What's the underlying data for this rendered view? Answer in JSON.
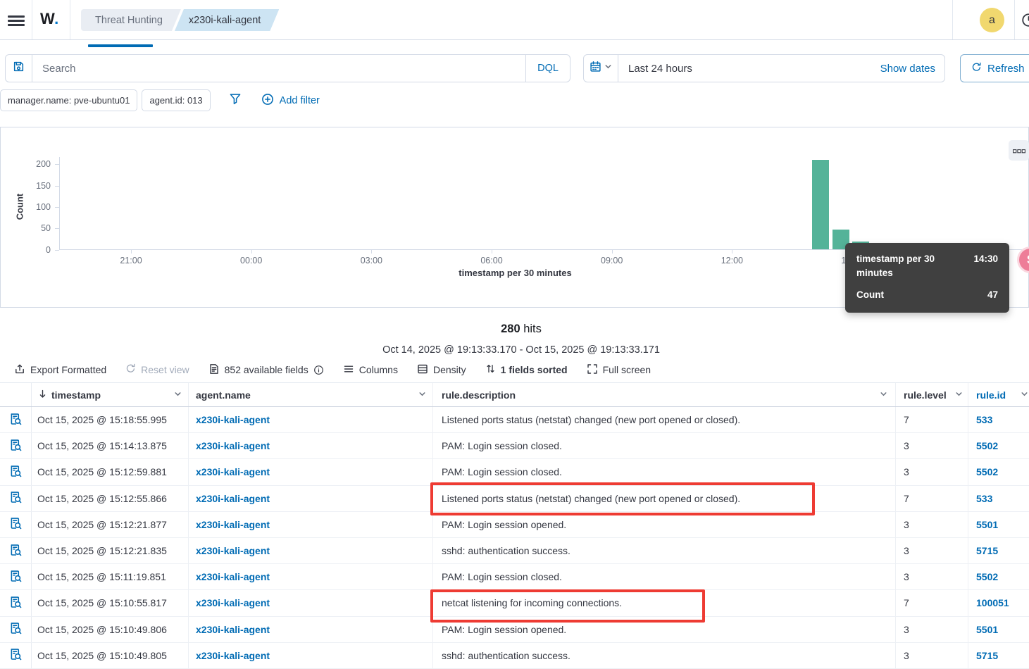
{
  "header": {
    "logo_text": "W",
    "logo_dot": ".",
    "breadcrumbs": [
      {
        "label": "Threat Hunting"
      },
      {
        "label": "x230i-kali-agent"
      }
    ],
    "avatar_initial": "a"
  },
  "search": {
    "placeholder": "Search",
    "language": "DQL"
  },
  "datepicker": {
    "range_label": "Last 24 hours",
    "show_dates_label": "Show dates",
    "refresh_label": "Refresh"
  },
  "filters": {
    "pills": [
      {
        "label": "manager.name: pve-ubuntu01"
      },
      {
        "label": "agent.id: 013"
      }
    ],
    "add_filter_label": "Add filter"
  },
  "chart_data": {
    "type": "bar",
    "title": "",
    "xlabel": "timestamp per 30 minutes",
    "ylabel": "Count",
    "x_ticks": [
      "21:00",
      "00:00",
      "03:00",
      "06:00",
      "09:00",
      "12:00",
      "15:00"
    ],
    "y_ticks": [
      0,
      50,
      100,
      150,
      200
    ],
    "ylim": [
      0,
      220
    ],
    "bars": [
      {
        "time": "14:00",
        "count": 211
      },
      {
        "time": "14:30",
        "count": 47
      },
      {
        "time": "15:00",
        "count": 19
      }
    ],
    "bar_color": "#54b399",
    "legend": "none",
    "grid": "off"
  },
  "tooltip": {
    "label": "timestamp per 30 minutes",
    "time": "14:30",
    "count_label": "Count",
    "count_value": "47"
  },
  "results": {
    "hits_count": "280",
    "hits_label": " hits",
    "range": "Oct 14, 2025 @ 19:13:33.170 - Oct 15, 2025 @ 19:13:33.171"
  },
  "toolbar": {
    "items": [
      {
        "icon": "export-icon",
        "label": "Export Formatted",
        "disabled": false,
        "bold": false,
        "info": false
      },
      {
        "icon": "reset-icon",
        "label": "Reset view",
        "disabled": true,
        "bold": false,
        "info": false
      },
      {
        "icon": "fields-icon",
        "label": "852 available fields",
        "disabled": false,
        "bold": false,
        "info": true
      },
      {
        "icon": "columns-icon",
        "label": "Columns",
        "disabled": false,
        "bold": false,
        "info": false
      },
      {
        "icon": "density-icon",
        "label": "Density",
        "disabled": false,
        "bold": false,
        "info": false
      },
      {
        "icon": "sort-icon",
        "label": "1 fields sorted",
        "disabled": false,
        "bold": true,
        "info": false
      },
      {
        "icon": "fullscreen-icon",
        "label": "Full screen",
        "disabled": false,
        "bold": false,
        "info": false
      }
    ]
  },
  "table": {
    "columns": {
      "timestamp": "timestamp",
      "agent": "agent.name",
      "description": "rule.description",
      "level": "rule.level",
      "id": "rule.id"
    },
    "rows": [
      {
        "timestamp": "Oct 15, 2025 @ 15:18:55.995",
        "agent": "x230i-kali-agent",
        "description": "Listened ports status (netstat) changed (new port opened or closed).",
        "level": "7",
        "id": "533"
      },
      {
        "timestamp": "Oct 15, 2025 @ 15:14:13.875",
        "agent": "x230i-kali-agent",
        "description": "PAM: Login session closed.",
        "level": "3",
        "id": "5502"
      },
      {
        "timestamp": "Oct 15, 2025 @ 15:12:59.881",
        "agent": "x230i-kali-agent",
        "description": "PAM: Login session closed.",
        "level": "3",
        "id": "5502"
      },
      {
        "timestamp": "Oct 15, 2025 @ 15:12:55.866",
        "agent": "x230i-kali-agent",
        "description": "Listened ports status (netstat) changed (new port opened or closed).",
        "level": "7",
        "id": "533"
      },
      {
        "timestamp": "Oct 15, 2025 @ 15:12:21.877",
        "agent": "x230i-kali-agent",
        "description": "PAM: Login session opened.",
        "level": "3",
        "id": "5501"
      },
      {
        "timestamp": "Oct 15, 2025 @ 15:12:21.835",
        "agent": "x230i-kali-agent",
        "description": "sshd: authentication success.",
        "level": "3",
        "id": "5715"
      },
      {
        "timestamp": "Oct 15, 2025 @ 15:11:19.851",
        "agent": "x230i-kali-agent",
        "description": "PAM: Login session closed.",
        "level": "3",
        "id": "5502"
      },
      {
        "timestamp": "Oct 15, 2025 @ 15:10:55.817",
        "agent": "x230i-kali-agent",
        "description": "netcat listening for incoming connections.",
        "level": "7",
        "id": "100051"
      },
      {
        "timestamp": "Oct 15, 2025 @ 15:10:49.806",
        "agent": "x230i-kali-agent",
        "description": "PAM: Login session opened.",
        "level": "3",
        "id": "5501"
      },
      {
        "timestamp": "Oct 15, 2025 @ 15:10:49.805",
        "agent": "x230i-kali-agent",
        "description": "sshd: authentication success.",
        "level": "3",
        "id": "5715"
      }
    ]
  },
  "annotations": {
    "color": "#ee3b33",
    "highlighted_descriptions": [
      "Listened ports status (netstat) changed (new port opened or closed).",
      "netcat listening for incoming connections."
    ]
  }
}
